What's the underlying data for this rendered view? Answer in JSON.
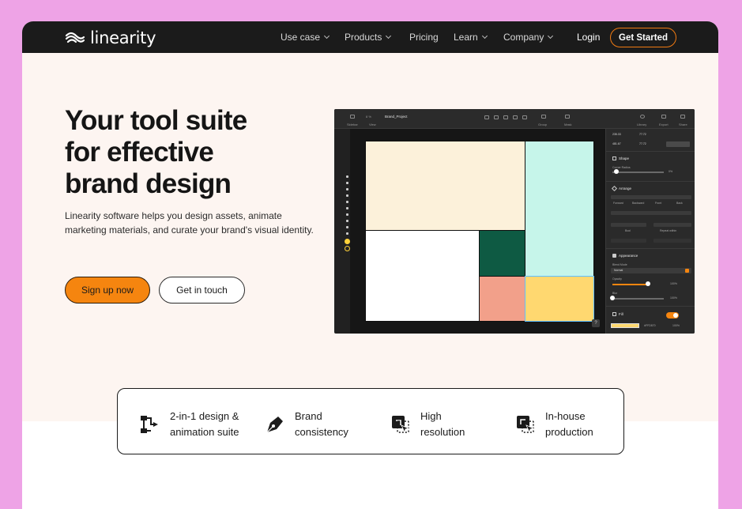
{
  "nav": {
    "logo": "linearity",
    "items": [
      {
        "label": "Use case",
        "dropdown": true
      },
      {
        "label": "Products",
        "dropdown": true
      },
      {
        "label": "Pricing",
        "dropdown": false
      },
      {
        "label": "Learn",
        "dropdown": true
      },
      {
        "label": "Company",
        "dropdown": true
      }
    ],
    "login": "Login",
    "cta": "Get Started"
  },
  "hero": {
    "headline": [
      "Your tool suite",
      "for effective",
      "brand design"
    ],
    "subline": [
      "Linearity software helps you design assets, animate",
      "marketing materials, and curate your brand's visual identity."
    ],
    "primary_button": "Sign up now",
    "secondary_button": "Get in touch"
  },
  "app_preview": {
    "project_name": "Brand_Project",
    "zoom": "8 %",
    "toolbar": {
      "sidebar": "Sidebar",
      "view": "View",
      "group": "Group",
      "mask": "Mask",
      "library": "Library",
      "export": "Export",
      "share": "Share"
    },
    "panel": {
      "x": "235.33",
      "y": "481.67",
      "w": "77.72",
      "h": "77.72",
      "shape_title": "Shape",
      "corner_radius_label": "Corner Radius",
      "corner_radius_value": "0%",
      "arrange_title": "Arrange",
      "arrange_buttons": [
        "Forward",
        "Backward",
        "Front",
        "Back"
      ],
      "bool_label": "Bool",
      "repeat_label": "Repeat within",
      "appearance_title": "Appearance",
      "blend_label": "Blend Mode",
      "blend_value": "Normal",
      "opacity_label": "Opacity",
      "opacity_value": "100%",
      "blur_label": "Blur",
      "blur_value": "100%",
      "fill_title": "Fill",
      "fill_hex": "#FFD870",
      "fill_opacity": "100%"
    },
    "help": "?",
    "colors": {
      "cream": "#fcf1da",
      "mint": "#c6f5ea",
      "white": "#ffffff",
      "green": "#0e5a43",
      "salmon": "#f2a08a",
      "yellow": "#ffd870",
      "orange_accent": "#f5850f"
    }
  },
  "features": [
    {
      "icon": "modules-icon",
      "lines": [
        "2-in-1 design &",
        "animation suite"
      ]
    },
    {
      "icon": "pen-nib-icon",
      "lines": [
        "Brand",
        "consistency"
      ]
    },
    {
      "icon": "cursor-select-icon",
      "lines": [
        "High",
        "resolution"
      ]
    },
    {
      "icon": "export-select-icon",
      "lines": [
        "In-house",
        "production"
      ]
    }
  ]
}
